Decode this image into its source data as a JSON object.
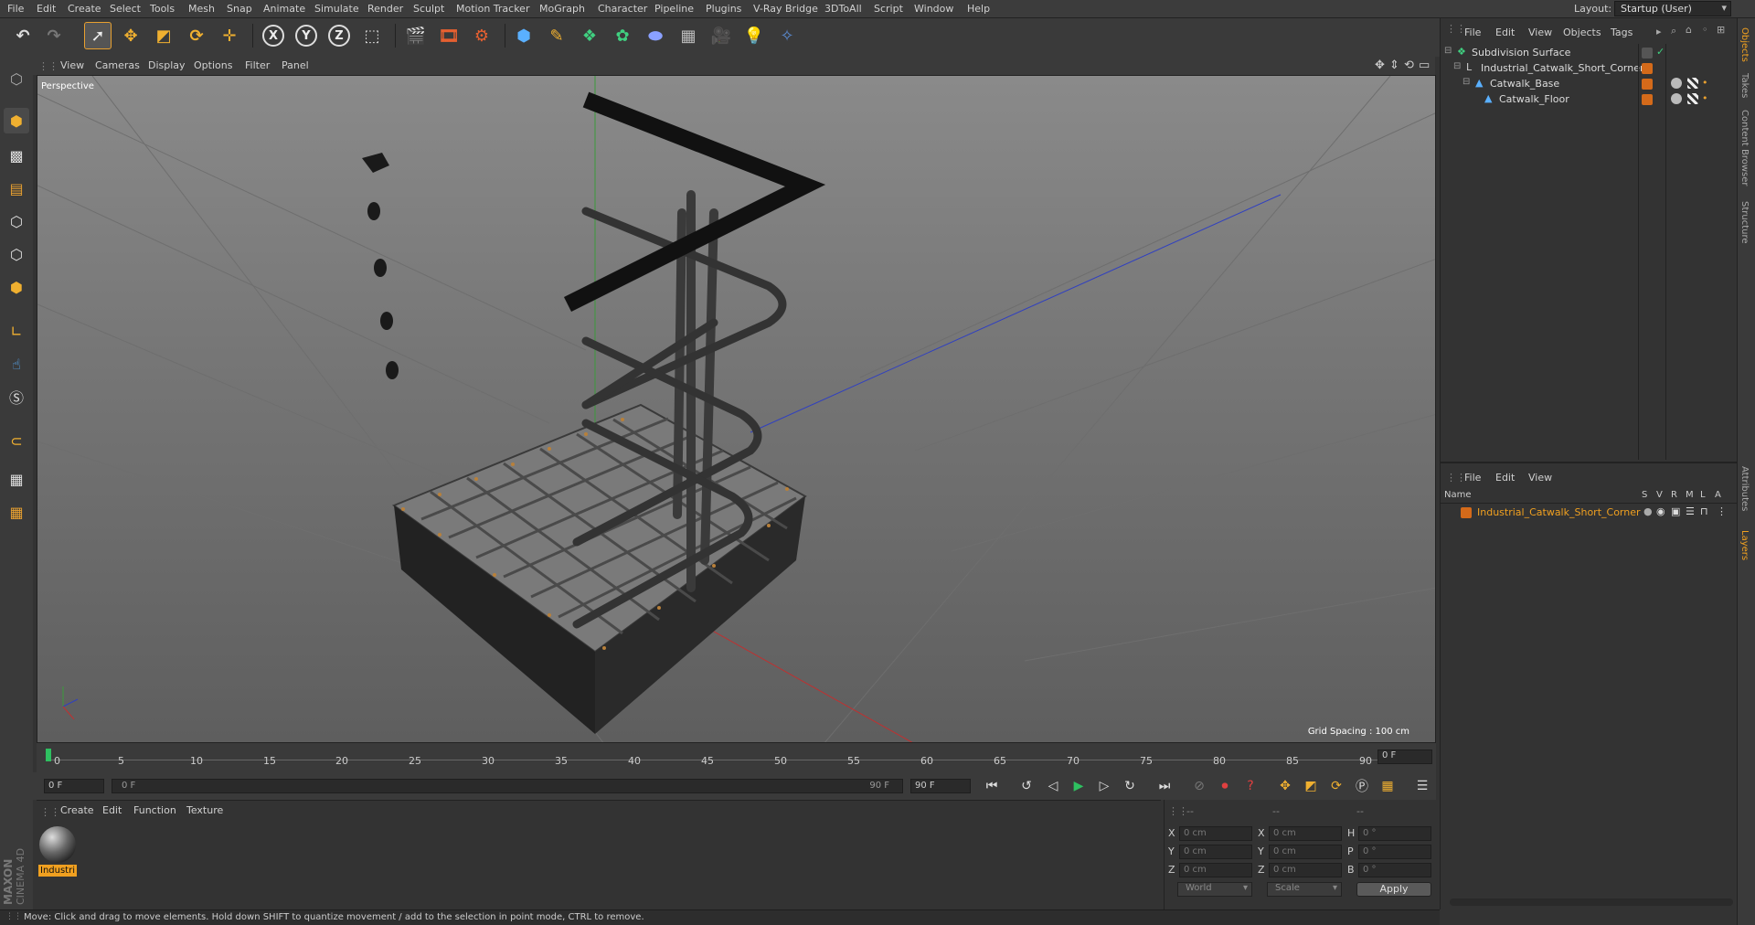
{
  "menu": [
    "File",
    "Edit",
    "Create",
    "Select",
    "Tools",
    "Mesh",
    "Snap",
    "Animate",
    "Simulate",
    "Render",
    "Sculpt",
    "Motion Tracker",
    "MoGraph",
    "Character",
    "Pipeline",
    "Plugins",
    "V-Ray Bridge",
    "3DToAll",
    "Script",
    "Window",
    "Help"
  ],
  "layout": {
    "label": "Layout:",
    "value": "Startup (User)"
  },
  "viewport_menu": [
    "View",
    "Cameras",
    "Display",
    "Options",
    "Filter",
    "Panel"
  ],
  "viewport": {
    "camera": "Perspective",
    "grid_spacing": "Grid Spacing : 100 cm"
  },
  "timeline": {
    "ticks": [
      "0",
      "5",
      "10",
      "15",
      "20",
      "25",
      "30",
      "35",
      "40",
      "45",
      "50",
      "55",
      "60",
      "65",
      "70",
      "75",
      "80",
      "85",
      "90"
    ],
    "frame_field": "0 F"
  },
  "transport": {
    "start": "0 F",
    "range_start": "0 F",
    "range_end": "90 F",
    "end": "90 F"
  },
  "material_menu": [
    "Create",
    "Edit",
    "Function",
    "Texture"
  ],
  "material": {
    "name": "Industri"
  },
  "coords": {
    "header": [
      "--",
      "--",
      "--"
    ],
    "rows": [
      {
        "a": "X",
        "v1": "0 cm",
        "b": "X",
        "v2": "0 cm",
        "c": "H",
        "v3": "0 °"
      },
      {
        "a": "Y",
        "v1": "0 cm",
        "b": "Y",
        "v2": "0 cm",
        "c": "P",
        "v3": "0 °"
      },
      {
        "a": "Z",
        "v1": "0 cm",
        "b": "Z",
        "v2": "0 cm",
        "c": "B",
        "v3": "0 °"
      }
    ],
    "world": "World",
    "scale": "Scale",
    "apply": "Apply"
  },
  "status": "Move: Click and drag to move elements. Hold down SHIFT to quantize movement / add to the selection in point mode, CTRL to remove.",
  "objects_menu": [
    "File",
    "Edit",
    "View",
    "Objects",
    "Tags"
  ],
  "objects": [
    {
      "name": "Subdivision Surface",
      "indent": 0
    },
    {
      "name": "Industrial_Catwalk_Short_Corner",
      "indent": 1
    },
    {
      "name": "Catwalk_Base",
      "indent": 2
    },
    {
      "name": "Catwalk_Floor",
      "indent": 3
    }
  ],
  "layers_menu": [
    "File",
    "Edit",
    "View"
  ],
  "layers_header": {
    "name": "Name",
    "cols": [
      "S",
      "V",
      "R",
      "M",
      "L",
      "A"
    ]
  },
  "layers": [
    {
      "name": "Industrial_Catwalk_Short_Corner",
      "color": "#d46a1a"
    }
  ],
  "side_tabs": [
    "Objects",
    "Takes",
    "Content Browser",
    "Structure",
    "Attributes",
    "Layers"
  ],
  "brand": {
    "maxon": "MAXON",
    "product": "CINEMA 4D"
  },
  "colors": {
    "accent": "#e8a030",
    "orange": "#d46a1a",
    "selected": "#f0a020"
  }
}
